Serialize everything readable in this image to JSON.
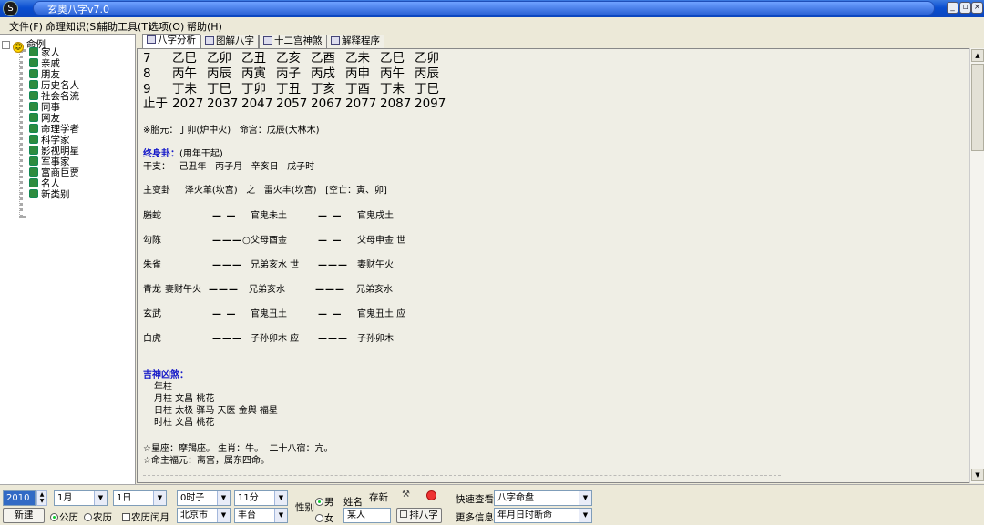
{
  "window": {
    "title": "玄奥八字v7.0"
  },
  "menu": [
    "文件(F)",
    "命理知识(S)",
    "辅助工具(T)",
    "选项(O)",
    "帮助(H)"
  ],
  "tree": {
    "root": "命例",
    "items": [
      "家人",
      "亲戚",
      "朋友",
      "历史名人",
      "社会名流",
      "同事",
      "网友",
      "命理学者",
      "科学家",
      "影视明星",
      "军事家",
      "富商巨贾",
      "名人",
      "新类别"
    ]
  },
  "tabs": [
    "八字分析",
    "图解八字",
    "十二宫神煞",
    "解释程序"
  ],
  "content": {
    "dayun_rows": [
      {
        "c0": "7",
        "cols": [
          "乙巳",
          "乙卯",
          "乙丑",
          "乙亥",
          "乙酉",
          "乙未",
          "乙巳",
          "乙卯"
        ]
      },
      {
        "c0": "8",
        "cols": [
          "丙午",
          "丙辰",
          "丙寅",
          "丙子",
          "丙戌",
          "丙申",
          "丙午",
          "丙辰"
        ]
      },
      {
        "c0": "9",
        "cols": [
          "丁未",
          "丁巳",
          "丁卯",
          "丁丑",
          "丁亥",
          "丁酉",
          "丁未",
          "丁巳"
        ]
      },
      {
        "c0": "止于",
        "cols": [
          "2027",
          "2037",
          "2047",
          "2057",
          "2067",
          "2077",
          "2087",
          "2097"
        ]
      }
    ],
    "taiyuan": "※胎元：丁卯(炉中火)   命宫：戊辰(大林木)",
    "zhongshen_title": "终身卦：",
    "zhongshen_note": "(用年干起)",
    "ganzhi": "干支：   己丑年   丙子月   辛亥日   戊子时",
    "guaxiang": "主变卦     泽火革(坎宫)   之   雷火丰(坎宫)   [空亡：寅、卯]",
    "yao_rows": [
      {
        "god": "螣蛇",
        "extra": "",
        "a": "— —",
        "b": "官鬼未土",
        "c": "— —",
        "d": "官鬼戌土"
      },
      {
        "god": "勾陈",
        "extra": "",
        "a": "———○",
        "b": "父母酉金",
        "c": "— —",
        "d": "父母申金 世"
      },
      {
        "god": "朱雀",
        "extra": "",
        "a": "———",
        "b": "兄弟亥水 世",
        "c": "———",
        "d": "妻财午火"
      },
      {
        "god": "青龙",
        "extra": "妻财午火",
        "a": "———",
        "b": "兄弟亥水",
        "c": "———",
        "d": "兄弟亥水"
      },
      {
        "god": "玄武",
        "extra": "",
        "a": "— —",
        "b": "官鬼丑土",
        "c": "— —",
        "d": "官鬼丑土 应"
      },
      {
        "god": "白虎",
        "extra": "",
        "a": "———",
        "b": "子孙卯木 应",
        "c": "———",
        "d": "子孙卯木"
      }
    ],
    "shensha_title": "吉神凶煞：",
    "shensha": [
      "年柱",
      "月柱 文昌 桃花",
      "日柱 太极 驿马 天医 金舆 福星",
      "时柱 文昌 桃花"
    ],
    "xingzuo": "☆星座：摩羯座。 生肖：牛。  二十八宿：亢。",
    "minggua": "☆命主福元：离宫，属东四命。"
  },
  "bottom": {
    "year": "2010",
    "month": "1月",
    "day": "1日",
    "hour": "0时子",
    "minute": "11分",
    "gender_label": "性别",
    "male": "男",
    "female": "女",
    "name_label": "姓名",
    "name_value": "某人",
    "save_label": "存新",
    "new_btn": "新建",
    "gongli": "公历",
    "nongli": "农历",
    "runyue": "农历闰月",
    "city": "北京市",
    "district": "丰台",
    "pai_btn": "排八字",
    "quick_label": "快速查看",
    "quick_value": "八字命盘",
    "more_label": "更多信息",
    "more_value": "年月日时断命"
  }
}
